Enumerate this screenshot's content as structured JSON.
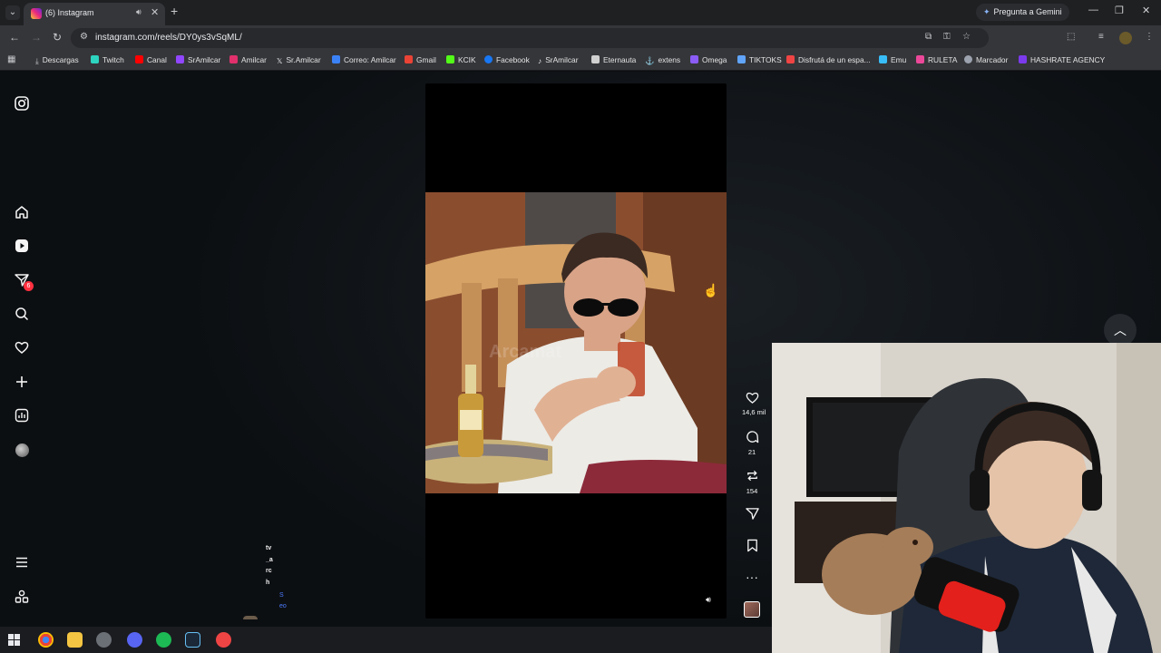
{
  "browser": {
    "tab": {
      "title": "(6) Instagram",
      "audio_icon": "speaker-icon",
      "close": "✕"
    },
    "new_tab": "+",
    "gemini_button": "Pregunta a Gemini",
    "url": "instagram.com/reels/DY0ys3vSqML/"
  },
  "bookmarks": [
    {
      "label": "Descargas",
      "color": "#c8c9cc"
    },
    {
      "label": "Twitch",
      "color": "#2dd4bf"
    },
    {
      "label": "Canal",
      "color": "#ff0000"
    },
    {
      "label": "SrAmilcar",
      "color": "#9146ff"
    },
    {
      "label": "Amilcar",
      "color": "#e1306c"
    },
    {
      "label": "Sr.Amilcar",
      "color": "#e8eaed"
    },
    {
      "label": "Correo: Amilcar",
      "color": "#3b82f6"
    },
    {
      "label": "Gmail",
      "color": "#ea4335"
    },
    {
      "label": "KCIK",
      "color": "#53fc18"
    },
    {
      "label": "Facebook",
      "color": "#1877f2"
    },
    {
      "label": "SrAmilcar",
      "color": "#e8eaed"
    },
    {
      "label": "Eternauta",
      "color": "#d0d0d0"
    },
    {
      "label": "extens",
      "color": "#e8eaed"
    },
    {
      "label": "Omega",
      "color": "#8b5cf6"
    },
    {
      "label": "TIKTOKS",
      "color": "#60a5fa"
    },
    {
      "label": "Disfrutá de un espa...",
      "color": "#ef4444"
    },
    {
      "label": "Emu",
      "color": "#38bdf8"
    },
    {
      "label": "RULETA",
      "color": "#ec4899"
    },
    {
      "label": "Marcador",
      "color": "#9ca3af"
    },
    {
      "label": "HASHRATE AGENCY",
      "color": "#7c3aed"
    }
  ],
  "instagram": {
    "notifications_count": "6",
    "caption_vertical": "tv_arch",
    "see_more_vertical": "Seo",
    "reel": {
      "watermark": "Arcamat",
      "likes": "14,6 mil",
      "comments": "21",
      "reposts": "154"
    }
  }
}
